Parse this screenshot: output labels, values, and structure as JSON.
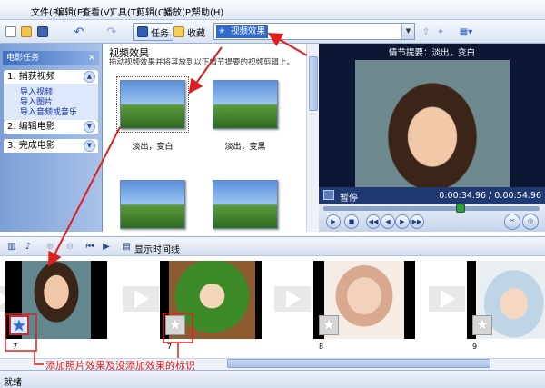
{
  "menu": [
    "文件(F)",
    "编辑(E)",
    "查看(V)",
    "工具(T)",
    "剪辑(C)",
    "播放(P)",
    "帮助(H)"
  ],
  "toolbar": {
    "tasks_label": "任务",
    "collections_label": "收藏",
    "effects_selected": "视频效果"
  },
  "taskpane": {
    "header": "电影任务",
    "close": "×",
    "sections": [
      {
        "title": "1. 捕获视频",
        "links": [
          "导入视频",
          "导入图片",
          "导入音频或音乐"
        ]
      },
      {
        "title": "2. 编辑电影"
      },
      {
        "title": "3. 完成电影"
      }
    ]
  },
  "gallery": {
    "title": "视频效果",
    "description": "拖动视频效果并将其放到以下情节提要的视频剪辑上。",
    "items": [
      "淡出，变白",
      "淡出，变黑",
      "",
      ""
    ]
  },
  "preview": {
    "title": "情节提要：淡出，变白",
    "status": "暂停",
    "time": "0:00:34.96 / 0:00:54.96",
    "progress": 0.64
  },
  "storyboard_toolbar": {
    "show_timeline": "显示时间线"
  },
  "storyboard": {
    "clips": [
      {
        "number": "7",
        "has_effect": true
      },
      {
        "number": "7",
        "has_effect": false
      },
      {
        "number": "8",
        "has_effect": false
      },
      {
        "number": "9",
        "has_effect": false
      }
    ],
    "star_symbol": "★"
  },
  "annotation": "添加照片效果及没添加效果的标识",
  "statusbar": "就绪",
  "colors": {
    "accent": "#3169c6",
    "annotation": "#e01e1e",
    "pane": "#7b9fd6"
  }
}
